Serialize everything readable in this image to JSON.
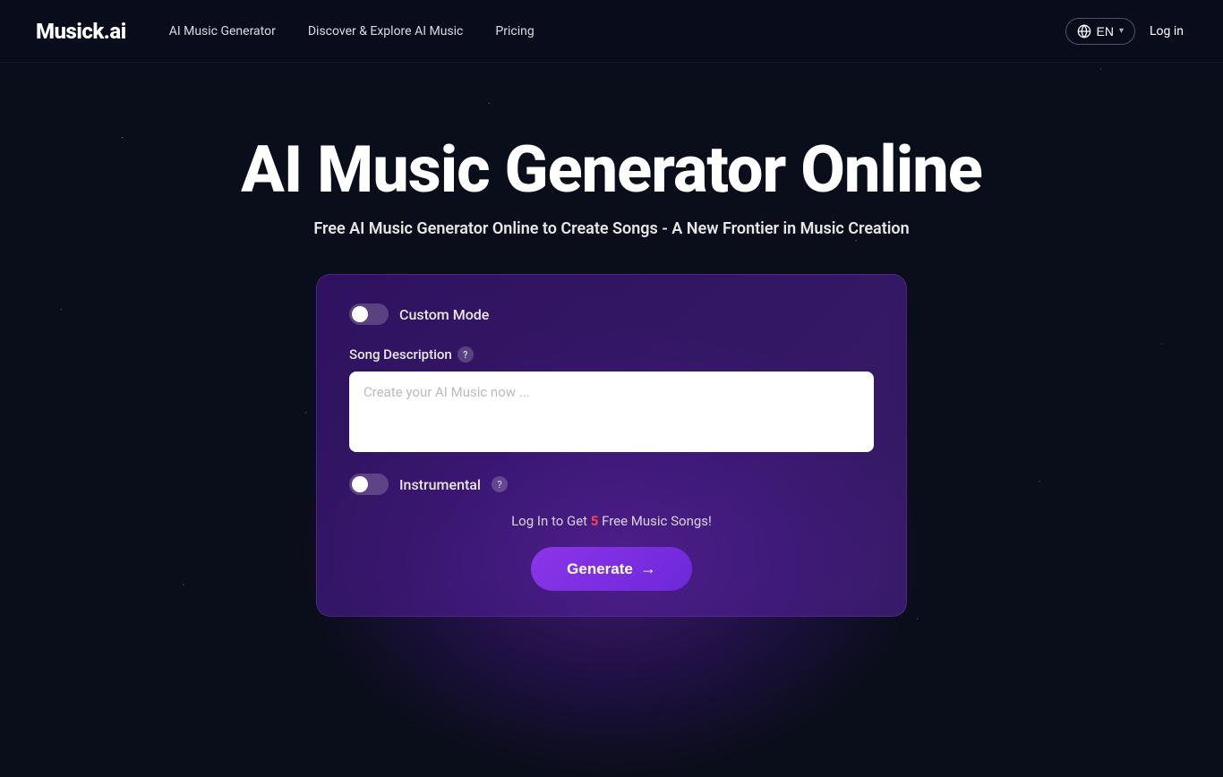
{
  "nav": {
    "logo": "Musick.ai",
    "links": [
      {
        "id": "ai-music-generator",
        "label": "AI Music Generator"
      },
      {
        "id": "discover-explore",
        "label": "Discover & Explore AI Music"
      },
      {
        "id": "pricing",
        "label": "Pricing"
      }
    ],
    "lang_label": "EN",
    "login_label": "Log in"
  },
  "hero": {
    "title": "AI Music Generator Online",
    "subtitle": "Free AI Music Generator Online to Create Songs - A New Frontier in Music Creation"
  },
  "card": {
    "custom_mode_label": "Custom Mode",
    "custom_mode_active": false,
    "song_description_label": "Song Description",
    "song_description_placeholder": "Create your AI Music now ...",
    "instrumental_label": "Instrumental",
    "instrumental_active": false,
    "login_prompt_pre": "Log In to Get ",
    "free_count": "5",
    "login_prompt_post": " Free Music Songs!",
    "generate_button_label": "Generate",
    "generate_button_arrow": "→"
  }
}
